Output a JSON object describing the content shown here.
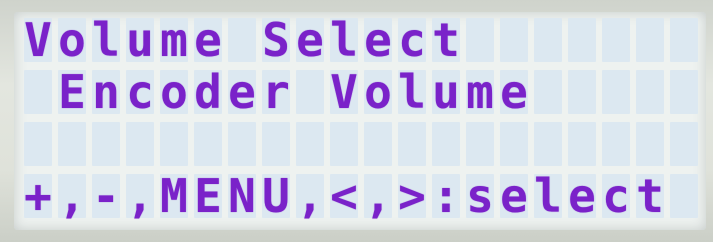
{
  "display": {
    "lines": [
      "Volume Select",
      " Encoder Volume",
      "",
      "+,-,MENU,<,>:select"
    ],
    "columns": 20,
    "rows": 4
  },
  "colors": {
    "pixel_on": "#7a22c9",
    "pixel_off": "#dce8f1",
    "background": "#eef2f0"
  }
}
